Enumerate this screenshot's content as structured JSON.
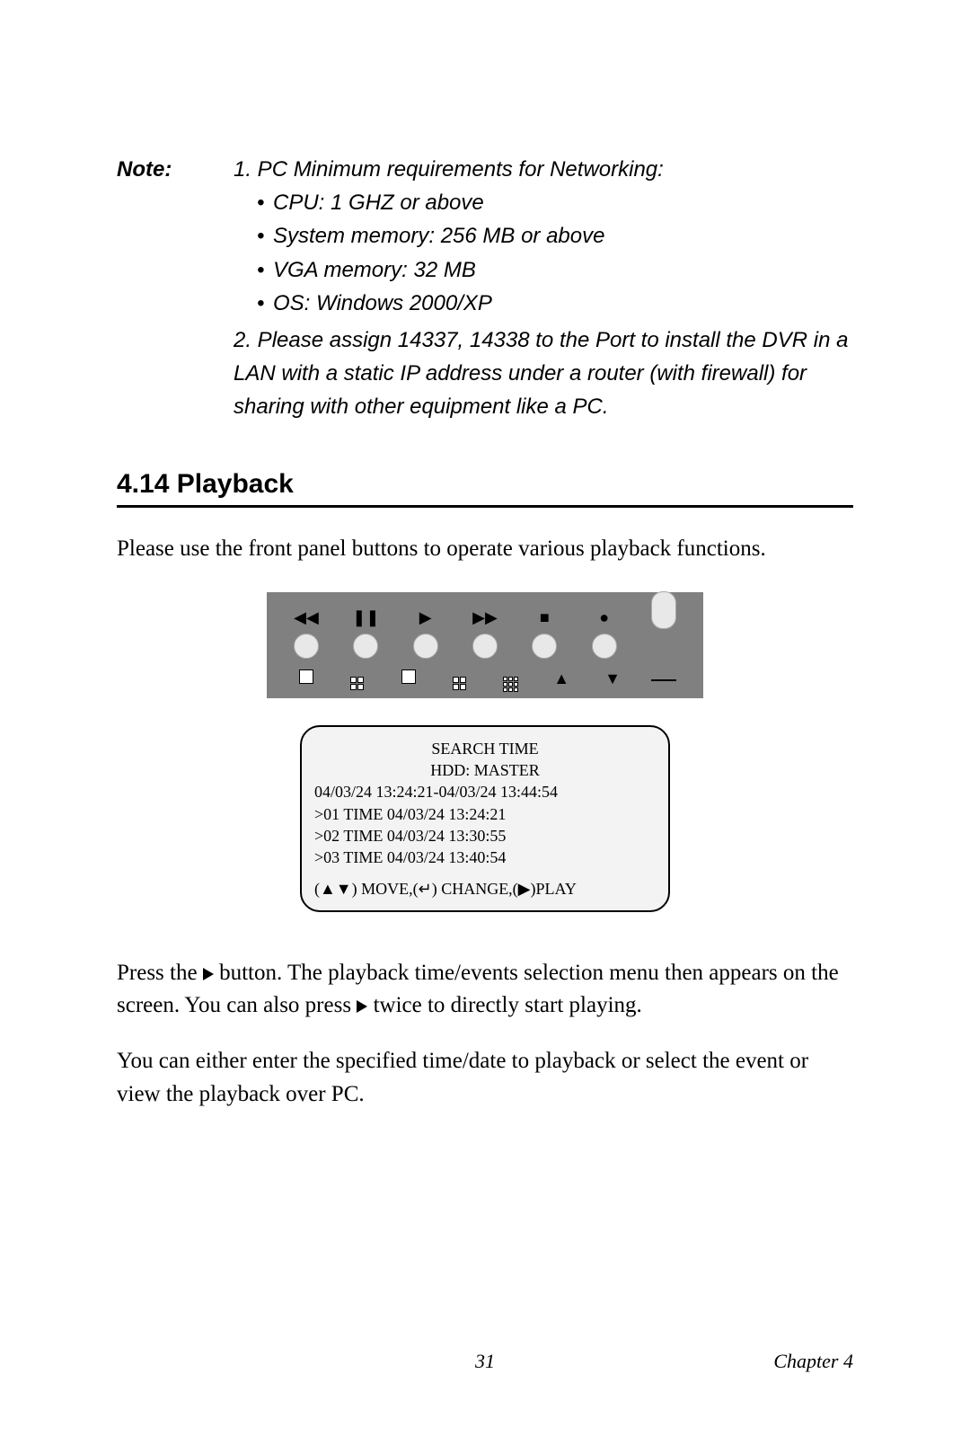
{
  "note": {
    "label": "Note:",
    "item1_lead": "1. PC Minimum requirements for Networking:",
    "bullets": {
      "b1": "CPU: 1 GHZ or above",
      "b2": "System memory: 256 MB or above",
      "b3": "VGA memory: 32 MB",
      "b4": "OS: Windows 2000/XP"
    },
    "item2": "2. Please assign 14337, 14338 to the Port to install the DVR in a LAN with a static IP address under a router (with firewall) for sharing with other equipment like a PC."
  },
  "section": {
    "heading": "4.14 Playback"
  },
  "body": {
    "p1": "Please use the front panel buttons to operate various playback functions.",
    "p2a": "Press the ",
    "p2b": " button. The playback time/events selection menu then appears on the screen. You can also press ",
    "p2c": " twice to directly start playing.",
    "p3": "You can either enter the specified time/date to playback or select the event or view the playback over PC."
  },
  "panel_icons": {
    "rewind": "◀◀",
    "pause": "❚❚",
    "play": "▶",
    "ffwd": "▶▶",
    "stop": "■",
    "record": "●",
    "up": "▲",
    "down": "▼"
  },
  "osd": {
    "l1": "SEARCH TIME",
    "l2": "HDD: MASTER",
    "l3": "04/03/24 13:24:21-04/03/24 13:44:54",
    "l4": ">01 TIME 04/03/24 13:24:21",
    "l5": ">02 TIME 04/03/24 13:30:55",
    "l6": ">03 TIME 04/03/24 13:40:54",
    "l7": "(▲▼) MOVE,(↵) CHANGE,(▶)PLAY"
  },
  "footer": {
    "page": "31",
    "chapter": "Chapter 4"
  }
}
